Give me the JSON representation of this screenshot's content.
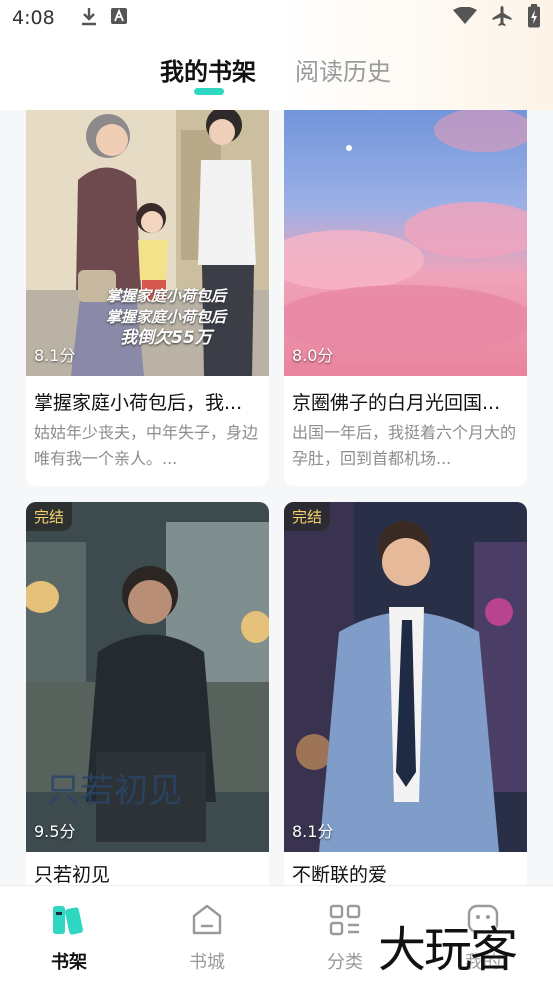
{
  "status_bar": {
    "time": "4:08"
  },
  "tabs": {
    "shelf": "我的书架",
    "history": "阅读历史"
  },
  "books": [
    {
      "score": "8.1分",
      "title": "掌握家庭小荷包后，我倒欠55万",
      "title_shown": "掌握家庭小荷包后，我...",
      "desc": "姑姑年少丧夫，中年失子，身边唯有我一个亲人。...",
      "cover_text_1": "掌握家庭小荷包后",
      "cover_text_2": "掌握家庭小荷包后",
      "cover_text_3": "我倒欠55万"
    },
    {
      "score": "8.0分",
      "title_shown": "京圈佛子的白月光回国...",
      "desc": "出国一年后，我挺着六个月大的孕肚，回到首都机场..."
    },
    {
      "badge": "完结",
      "score": "9.5分",
      "title_shown": "只若初见"
    },
    {
      "badge": "完结",
      "score": "8.1分",
      "title_shown": "不断联的爱"
    }
  ],
  "nav": {
    "shelf": "书架",
    "store": "书城",
    "category": "分类",
    "mine": "我的"
  },
  "watermark": "大玩客",
  "colors": {
    "accent": "#2fd6c2",
    "badge_text": "#f8d36a"
  }
}
